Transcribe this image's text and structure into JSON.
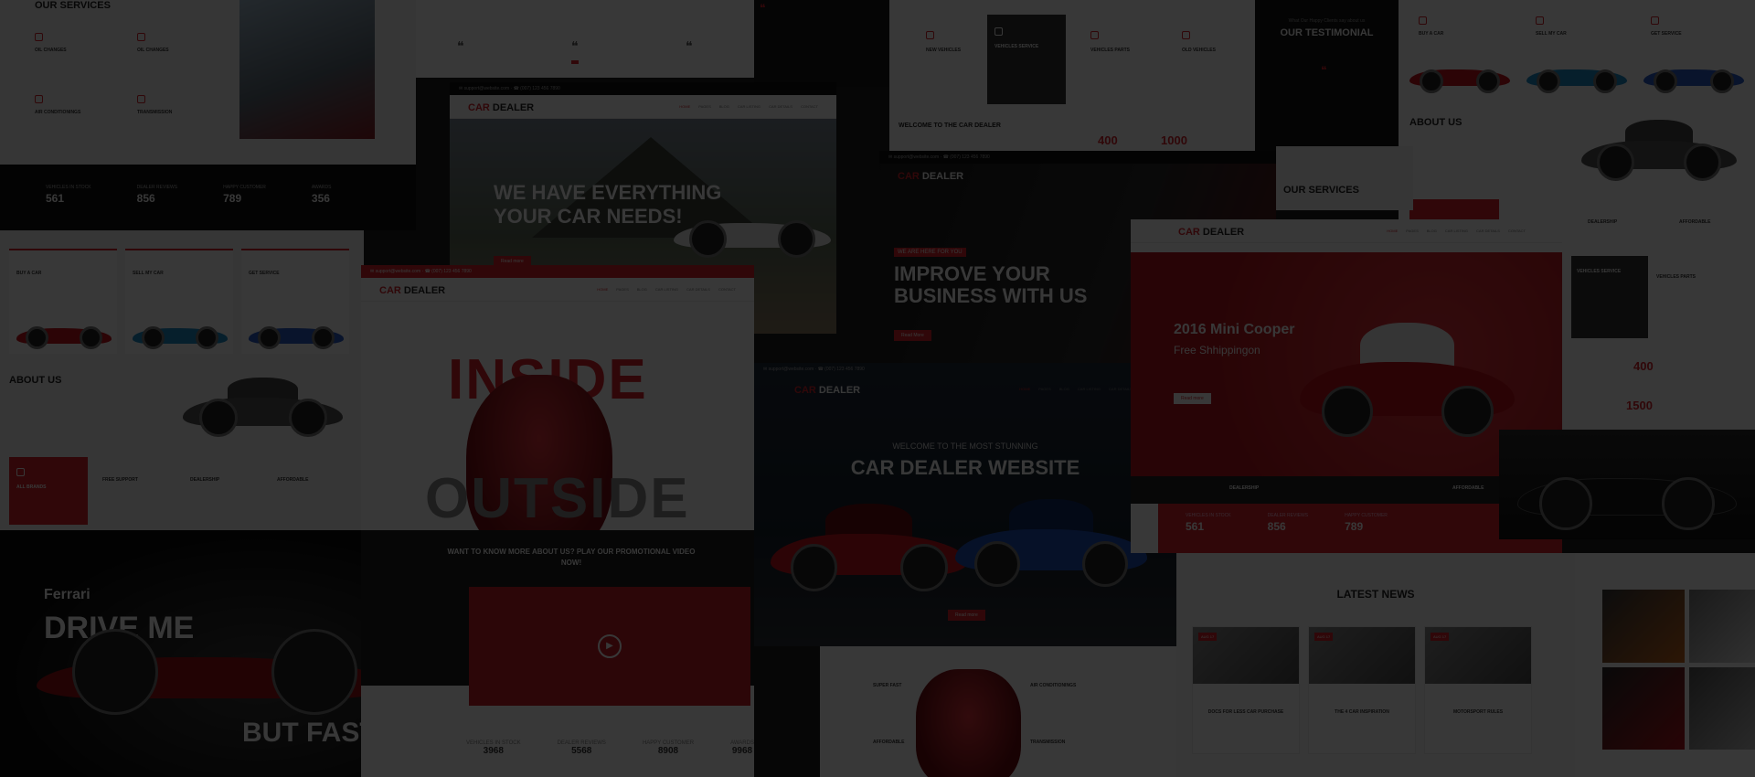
{
  "shots": {
    "services": {
      "title": "OUR SERVICES",
      "items": [
        "OIL CHANGES",
        "OIL CHANGES",
        "AIR CONDITIONINGS",
        "TRANSMISSION"
      ]
    },
    "counters_dark": {
      "items": [
        {
          "label": "VEHICLES IN STOCK",
          "value": "561"
        },
        {
          "label": "DEALER REVIEWS",
          "value": "856"
        },
        {
          "label": "HAPPY CUSTOMER",
          "value": "789"
        },
        {
          "label": "AWARDS",
          "value": "356"
        }
      ]
    },
    "left_services": {
      "cards": [
        "BUY A CAR",
        "SELL MY CAR",
        "GET SERVICE"
      ],
      "about_title": "ABOUT US",
      "features": [
        "ALL BRANDS",
        "FREE SUPPORT",
        "DEALERSHIP",
        "AFFORDABLE"
      ]
    },
    "ferrari": {
      "brand": "Ferrari",
      "line1": "DRIVE ME",
      "line2": "BUT FAST!"
    },
    "hero_everything": {
      "logo_a": "CAR",
      "logo_b": " DEALER",
      "headline1": "WE HAVE EVERYTHING",
      "headline2": "YOUR CAR NEEDS!",
      "button": "Read more",
      "nav": [
        "HOME",
        "PAGES",
        "BLOG",
        "CAR LISTING",
        "CAR DETAILS",
        "CONTACT"
      ]
    },
    "inside_outside": {
      "logo_a": "CAR",
      "logo_b": " DEALER",
      "word1": "INSIDE",
      "word2": "OUTSIDE",
      "cta": "WANT TO KNOW MORE ABOUT US? PLAY OUR PROMOTIONAL VIDEO NOW!",
      "counters": [
        {
          "label": "VEHICLES IN STOCK",
          "value": "3968"
        },
        {
          "label": "DEALER REVIEWS",
          "value": "5568"
        },
        {
          "label": "HAPPY CUSTOMER",
          "value": "8908"
        },
        {
          "label": "AWARDS",
          "value": "9968"
        }
      ],
      "nav": [
        "HOME",
        "PAGES",
        "BLOG",
        "CAR LISTING",
        "CAR DETAILS",
        "CONTACT"
      ]
    },
    "improve": {
      "logo_a": "CAR",
      "logo_b": " DEALER",
      "kicker": "WE ARE HERE FOR YOU",
      "headline1": "IMPROVE YOUR",
      "headline2": "BUSINESS WITH US",
      "button": "Read More"
    },
    "stunning": {
      "logo_a": "CAR",
      "logo_b": " DEALER",
      "pre": "WELCOME TO THE MOST STUNNING",
      "title": "CAR DEALER WEBSITE",
      "button": "Read more",
      "nav": [
        "HOME",
        "PAGES",
        "BLOG",
        "CAR LISTING",
        "CAR DETAILS",
        "CONTACT"
      ],
      "features": [
        "SUPER FAST",
        "AIR CONDITIONINGS",
        "AFFORDABLE",
        "TRANSMISSION"
      ]
    },
    "vehicle_services": {
      "items": [
        "NEW VEHICLES",
        "VEHICLES SERVICE",
        "VEHICLES PARTS",
        "OLD VEHICLES"
      ],
      "welcome": "WELCOME TO THE CAR DEALER",
      "num1": "400",
      "num2": "1000"
    },
    "testimonial": {
      "pre": "What Our Happy Clients say about us",
      "title": "OUR TESTIMONIAL"
    },
    "mini_cooper": {
      "logo_a": "CAR",
      "logo_b": " DEALER",
      "title": "2016 Mini Cooper",
      "subtitle": "Free Shhippingon",
      "button": "Read more",
      "nav": [
        "HOME",
        "PAGES",
        "BLOG",
        "CAR LISTING",
        "CAR DETAILS",
        "CONTACT"
      ],
      "bottom": [
        "DEALERSHIP",
        "AFFORDABLE"
      ],
      "counters": [
        {
          "label": "VEHICLES IN STOCK",
          "value": "561"
        },
        {
          "label": "DEALER REVIEWS",
          "value": "856"
        },
        {
          "label": "HAPPY CUSTOMER",
          "value": "789"
        }
      ]
    },
    "right_top": {
      "cards": [
        "BUY A CAR",
        "SELL MY CAR",
        "GET SERVICE"
      ],
      "about_title": "ABOUT US",
      "features": [
        "DEALERSHIP",
        "AFFORDABLE"
      ],
      "services_title": "OUR SERVICES",
      "parts": [
        "VEHICLES SERVICE",
        "VEHICLES PARTS"
      ],
      "num1": "400",
      "num2": "1500"
    },
    "news": {
      "title": "LATEST NEWS",
      "items": [
        {
          "tag": "AUG 17",
          "title": "DOCS FOR LESS CAR PURCHASE"
        },
        {
          "tag": "AUG 17",
          "title": "THE 4 CAR INSPIRATION"
        },
        {
          "tag": "AUG 17",
          "title": "MOTORSPORT RULES"
        }
      ]
    }
  }
}
